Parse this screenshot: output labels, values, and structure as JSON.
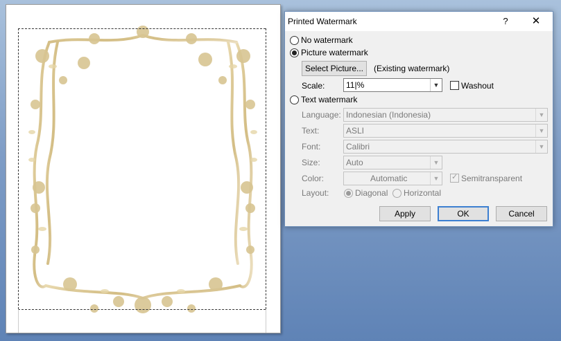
{
  "dialog": {
    "title": "Printed Watermark",
    "help_label": "?",
    "close_label": "✕",
    "no_watermark_label": "No watermark",
    "picture_watermark_label": "Picture watermark",
    "select_picture_label": "Select Picture...",
    "existing_watermark_label": "(Existing watermark)",
    "scale_label": "Scale:",
    "scale_value": "11|%",
    "washout_label": "Washout",
    "text_watermark_label": "Text watermark",
    "language_label": "Language:",
    "language_value": "Indonesian (Indonesia)",
    "text_label": "Text:",
    "text_value": "ASLI",
    "font_label": "Font:",
    "font_value": "Calibri",
    "size_label": "Size:",
    "size_value": "Auto",
    "color_label": "Color:",
    "color_value": "Automatic",
    "semitransparent_label": "Semitransparent",
    "layout_label": "Layout:",
    "diagonal_label": "Diagonal",
    "horizontal_label": "Horizontal",
    "apply_label": "Apply",
    "ok_label": "OK",
    "cancel_label": "Cancel",
    "selected_option": "picture",
    "selected_layout": "diagonal",
    "washout_checked": false,
    "semitransparent_checked": true
  },
  "document": {
    "frame_color": "#d9c48f",
    "frame_icon": "floral-rose-frame"
  },
  "colors": {
    "accent": "#3c7fd1",
    "desktop": "#6f90c0"
  }
}
